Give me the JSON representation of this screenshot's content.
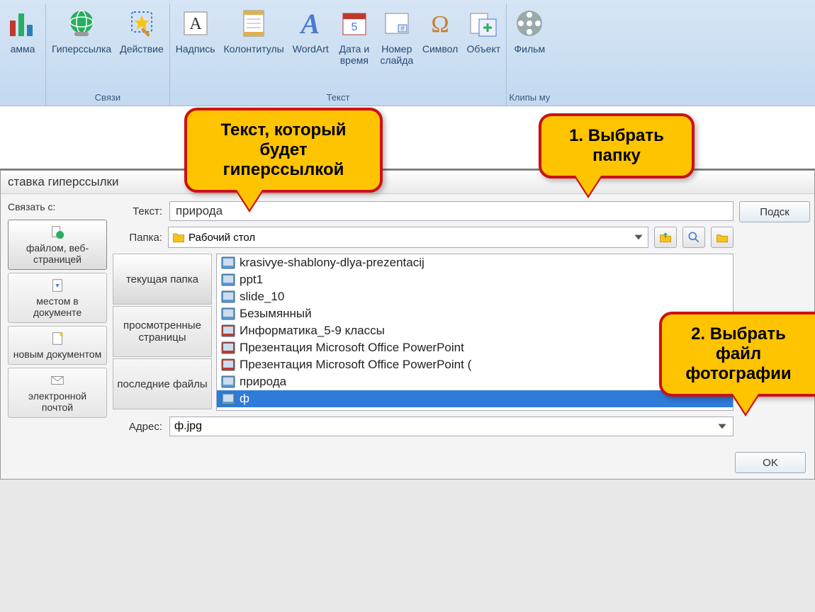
{
  "ribbon": {
    "groups": [
      {
        "label": "",
        "items": [
          {
            "label": "амма"
          }
        ]
      },
      {
        "label": "Связи",
        "items": [
          {
            "label": "Гиперссылка"
          },
          {
            "label": "Действие"
          }
        ]
      },
      {
        "label": "Текст",
        "items": [
          {
            "label": "Надпись"
          },
          {
            "label": "Колонтитулы"
          },
          {
            "label": "WordArt"
          },
          {
            "label": "Дата и\nвремя"
          },
          {
            "label": "Номер\nслайда"
          },
          {
            "label": "Символ"
          },
          {
            "label": "Объект"
          }
        ]
      },
      {
        "label": "Клипы му",
        "items": [
          {
            "label": "Фильм"
          }
        ]
      }
    ]
  },
  "dialog": {
    "title": "ставка гиперссылки",
    "link_label": "Связать с:",
    "link_options": [
      "файлом, веб-страницей",
      "местом в документе",
      "новым документом",
      "электронной почтой"
    ],
    "text_label": "Текст:",
    "text_value": "природа",
    "tooltip_btn": "Подск",
    "folder_label": "Папка:",
    "folder_value": "Рабочий стол",
    "tabs": [
      "текущая папка",
      "просмотренные страницы",
      "последние файлы"
    ],
    "files": [
      "krasivye-shablony-dlya-prezentacij",
      "ppt1",
      "slide_10",
      "Безымянный",
      "Информатика_5-9 классы",
      "Презентация Microsoft Office PowerPoint",
      "Презентация Microsoft Office PowerPoint (",
      "природа",
      "ф"
    ],
    "selected_file_index": 8,
    "address_label": "Адрес:",
    "address_value": "ф.jpg",
    "ok": "OK"
  },
  "callouts": {
    "c1": "Текст, который будет гиперссылкой",
    "c2": "1. Выбрать папку",
    "c3": "2. Выбрать файл фотографии"
  }
}
